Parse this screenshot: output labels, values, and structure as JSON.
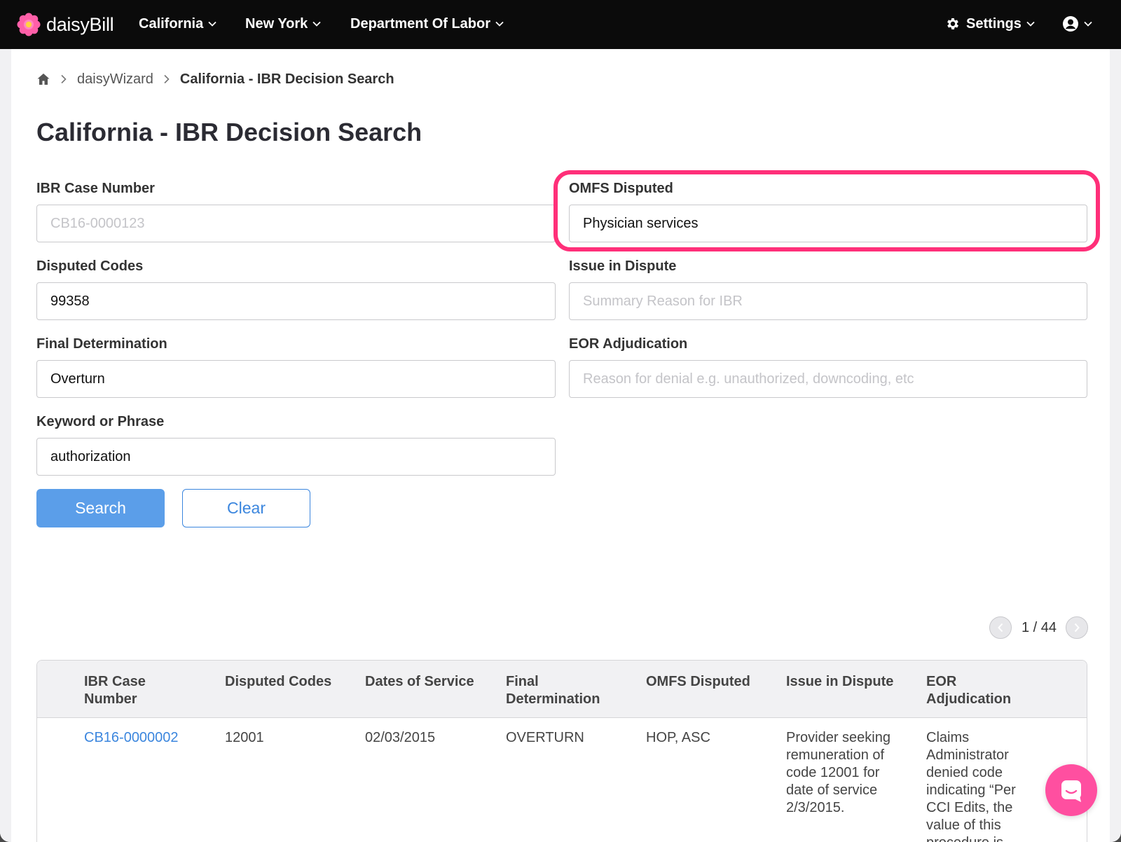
{
  "nav": {
    "brand": "daisyBill",
    "items": [
      {
        "label": "California"
      },
      {
        "label": "New York"
      },
      {
        "label": "Department Of Labor"
      }
    ],
    "settings": "Settings"
  },
  "breadcrumb": {
    "items": [
      "daisyWizard",
      "California - IBR Decision Search"
    ]
  },
  "page": {
    "title": "California - IBR Decision Search"
  },
  "form": {
    "ibr_case_number": {
      "label": "IBR Case Number",
      "placeholder": "CB16-0000123",
      "value": ""
    },
    "omfs_disputed": {
      "label": "OMFS Disputed",
      "placeholder": "",
      "value": "Physician services"
    },
    "disputed_codes": {
      "label": "Disputed Codes",
      "placeholder": "",
      "value": "99358"
    },
    "issue_in_dispute": {
      "label": "Issue in Dispute",
      "placeholder": "Summary Reason for IBR",
      "value": ""
    },
    "final_determination": {
      "label": "Final Determination",
      "placeholder": "",
      "value": "Overturn"
    },
    "eor_adjudication": {
      "label": "EOR Adjudication",
      "placeholder": "Reason for denial e.g. unauthorized, downcoding, etc",
      "value": ""
    },
    "keyword": {
      "label": "Keyword or Phrase",
      "placeholder": "",
      "value": "authorization"
    },
    "search_label": "Search",
    "clear_label": "Clear"
  },
  "pager": {
    "text": "1 / 44"
  },
  "table": {
    "headers": [
      [
        "IBR Case",
        "Number"
      ],
      [
        "Disputed Codes"
      ],
      [
        "Dates of Service"
      ],
      [
        "Final",
        "Determination"
      ],
      [
        "OMFS Disputed"
      ],
      [
        "Issue in Dispute"
      ],
      [
        "EOR",
        "Adjudication"
      ]
    ],
    "rows": [
      {
        "case_number": "CB16-0000002",
        "disputed_codes": "12001",
        "dates_of_service": "02/03/2015",
        "final_determination": "OVERTURN",
        "omfs_disputed": "HOP, ASC",
        "issue_in_dispute": [
          "Provider seeking",
          "remuneration of",
          "code 12001 for",
          "date of service",
          "2/3/2015."
        ],
        "eor_adjudication": [
          "Claims",
          "Administrator",
          "denied code",
          "indicating “Per",
          "CCI Edits, the",
          "value of this",
          "procedure is"
        ]
      }
    ]
  },
  "colors": {
    "nav_bg": "#0b0b0b",
    "primary": "#5b9ee9",
    "link": "#3b86de",
    "highlight": "#ff2f79",
    "chat": "#ff4fa0"
  }
}
